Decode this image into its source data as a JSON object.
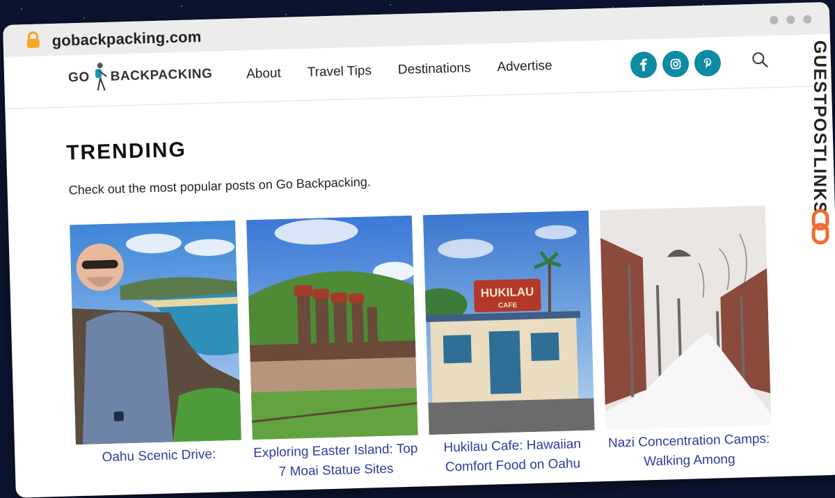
{
  "browser": {
    "url": "gobackpacking.com"
  },
  "site": {
    "logo_text": "BACKPACKING",
    "logo_prefix": "GO",
    "nav": [
      "About",
      "Travel Tips",
      "Destinations",
      "Advertise"
    ],
    "socials": [
      "facebook-icon",
      "instagram-icon",
      "pinterest-icon"
    ]
  },
  "trending": {
    "title": "TRENDING",
    "subtitle": "Check out the most popular posts on Go Backpacking.",
    "posts": [
      {
        "caption": "Oahu Scenic Drive:"
      },
      {
        "caption": "Exploring Easter Island: Top 7 Moai Statue Sites"
      },
      {
        "caption": "Hukilau Cafe: Hawaiian Comfort Food on Oahu"
      },
      {
        "caption": "Nazi Concentration Camps: Walking Among"
      }
    ],
    "cafe_sign_top": "HUKILAU",
    "cafe_sign_bottom": "CAFE"
  },
  "watermark": {
    "text": "GUESTPOSTLINKS"
  },
  "colors": {
    "accent": "#0f8aa3",
    "link": "#2b3d9e",
    "background": "#0c1530",
    "watermark_orange": "#f26a2e"
  }
}
